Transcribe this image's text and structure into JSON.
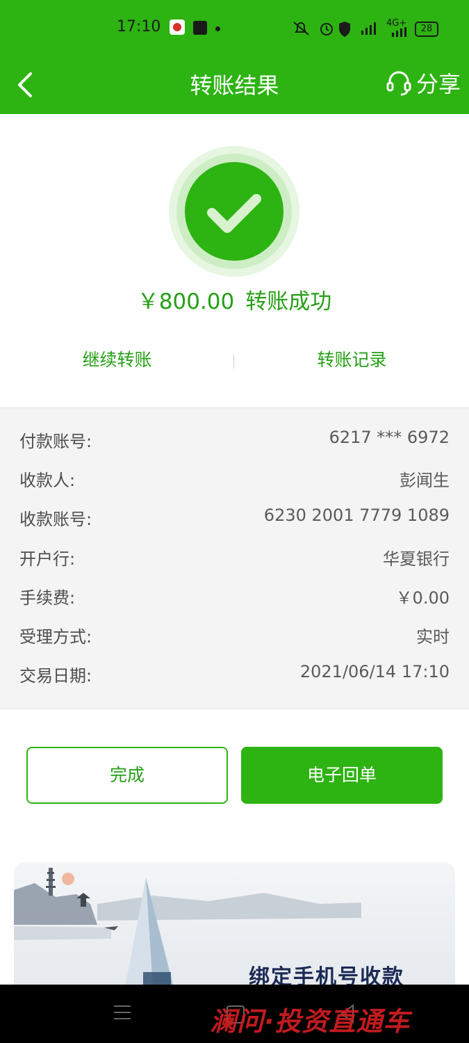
{
  "status_bar": {
    "time": "17:10",
    "network": "4G+",
    "battery": "28"
  },
  "header": {
    "title": "转账结果",
    "share_label": "分享"
  },
  "result": {
    "amount": "￥800.00",
    "status_text": "转账成功"
  },
  "actions": {
    "continue_transfer": "继续转账",
    "transfer_records": "转账记录"
  },
  "details": [
    {
      "label": "付款账号:",
      "value": "6217 *** 6972"
    },
    {
      "label": "收款人:",
      "value": "彭闻生"
    },
    {
      "label": "收款账号:",
      "value": "6230 2001 7779 1089"
    },
    {
      "label": "开户行:",
      "value": "华夏银行"
    },
    {
      "label": "手续费:",
      "value": "￥0.00"
    },
    {
      "label": "受理方式:",
      "value": "实时"
    },
    {
      "label": "交易日期:",
      "value": "2021/06/14 17:10"
    }
  ],
  "buttons": {
    "done": "完成",
    "e_receipt": "电子回单"
  },
  "banner": {
    "text": "绑定手机号收款"
  },
  "watermark": {
    "text": "澜问·投资直通车"
  },
  "colors": {
    "brand_green": "#2db312",
    "text_green": "#25a016"
  }
}
